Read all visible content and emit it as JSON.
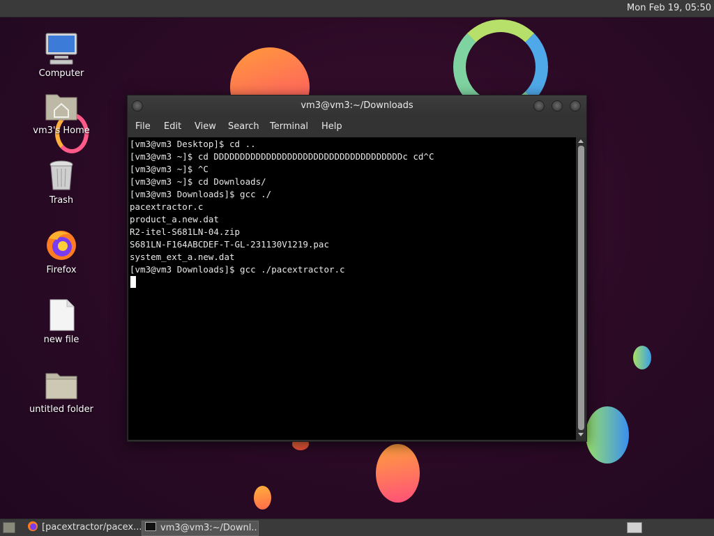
{
  "top_panel": {
    "clock": "Mon Feb 19, 05:50"
  },
  "desktop_icons": [
    {
      "label": "Computer",
      "icon": "computer-icon"
    },
    {
      "label": "vm3's Home",
      "icon": "home-folder-icon"
    },
    {
      "label": "Trash",
      "icon": "trash-icon"
    },
    {
      "label": "Firefox",
      "icon": "firefox-icon"
    },
    {
      "label": "new file",
      "icon": "file-icon"
    },
    {
      "label": "untitled folder",
      "icon": "folder-icon"
    }
  ],
  "window": {
    "title": "vm3@vm3:~/Downloads",
    "menu": [
      "File",
      "Edit",
      "View",
      "Search",
      "Terminal",
      "Help"
    ],
    "terminal_lines": [
      "[vm3@vm3 Desktop]$ cd ..",
      "[vm3@vm3 ~]$ cd DDDDDDDDDDDDDDDDDDDDDDDDDDDDDDDDDDDDc cd^C",
      "[vm3@vm3 ~]$ ^C",
      "[vm3@vm3 ~]$ cd Downloads/",
      "[vm3@vm3 Downloads]$ gcc ./",
      "pacextractor.c",
      "product_a.new.dat",
      "R2-itel-S681LN-04.zip",
      "S681LN-F164ABCDEF-T-GL-231130V1219.pac",
      "system_ext_a.new.dat",
      "[vm3@vm3 Downloads]$ gcc ./pacextractor.c"
    ]
  },
  "taskbar": {
    "tasks": [
      {
        "label": "[pacextractor/pacex...",
        "icon": "firefox-icon",
        "active": false
      },
      {
        "label": "vm3@vm3:~/Downl...",
        "icon": "terminal-icon",
        "active": true
      }
    ]
  }
}
